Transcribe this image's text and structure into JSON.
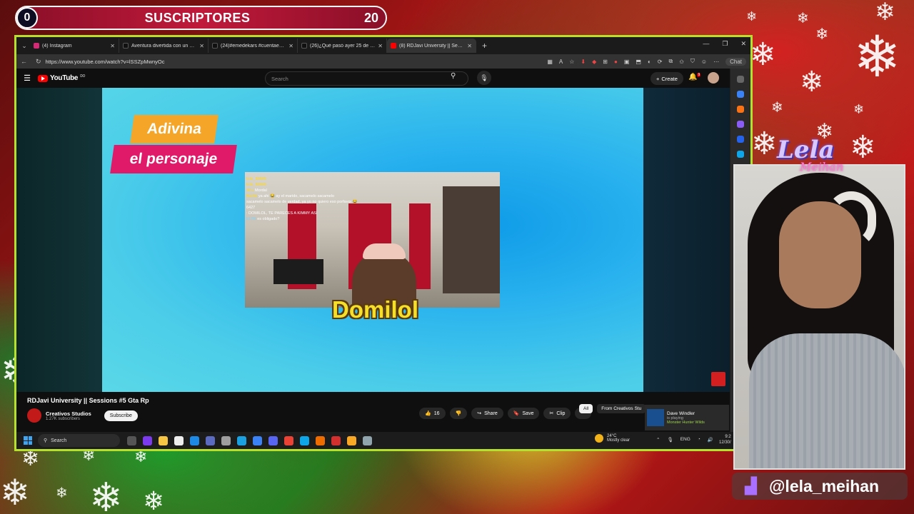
{
  "overlay": {
    "subscriber_count": "0",
    "subscriber_title": "SUSCRIPTORES",
    "subscriber_goal": "20",
    "streamer_logo": "Lela",
    "streamer_logo_sub": "Meihan",
    "handle": "@lela_meihan",
    "handle_icon": "twitch-icon"
  },
  "browser": {
    "tabs": [
      {
        "title": "(4) Instagram",
        "color": "#d62976",
        "active": false
      },
      {
        "title": "Aventura divertida con un gato vo",
        "color": "#111111",
        "active": false
      },
      {
        "title": "(24)#emedekars #cuentaendecade",
        "color": "#111111",
        "active": false
      },
      {
        "title": "(26)¿Qué pasó ayer 25 de Dic? mo",
        "color": "#111111",
        "active": false
      },
      {
        "title": "(8) RDJavi University || Sessions #5",
        "color": "#ff0000",
        "active": true
      }
    ],
    "url": "https://www.youtube.com/watch?v=lSSZpMwnyOc",
    "chat_label": "Chat"
  },
  "youtube": {
    "logo_text": "YouTube",
    "logo_region": "DO",
    "search_placeholder": "Search",
    "create_label": "Create",
    "notif_count": "9",
    "video": {
      "badge_line1": "Adivina",
      "badge_line2": "el personaje",
      "clip_name": "Domilol",
      "chat_lines": [
        {
          "user": "lelo_38383",
          "text": ""
        },
        {
          "user": "lelo_38383",
          "text": ""
        },
        {
          "user": "12 ♦",
          "text": "Mordal"
        },
        {
          "user": "Budie",
          "text": "ya ahi 😂 ay el marido, sacamelo sacamelo"
        },
        {
          "user": "",
          "text": "sacamelo sacamelo de verdad, ya yo no quiero eso porfavor 😂"
        },
        {
          "user": "",
          "text": "6427"
        },
        {
          "user": "",
          "text": ": DOMILOL, TE PARECES A KIMMY ASI"
        },
        {
          "user": "ELTR",
          "text": "es obligado?"
        }
      ]
    },
    "title": "RDJavi University || Sessions #5 Gta Rp",
    "channel": "Creativos Studios",
    "subscribers": "1.27K subscribers",
    "subscribe_label": "Subscribe",
    "likes": "16",
    "share_label": "Share",
    "save_label": "Save",
    "clip_label": "Clip",
    "chips": [
      "All",
      "From Creativos Stu"
    ],
    "toast": {
      "name": "Dave Windler",
      "status": "is playing",
      "game": "Monster Hunter Wilds"
    }
  },
  "taskbar": {
    "search_placeholder": "Search",
    "temp": "24°C",
    "weather": "Mostly clear",
    "lang": "ENG",
    "time": "9:2",
    "date": "12/30/"
  }
}
